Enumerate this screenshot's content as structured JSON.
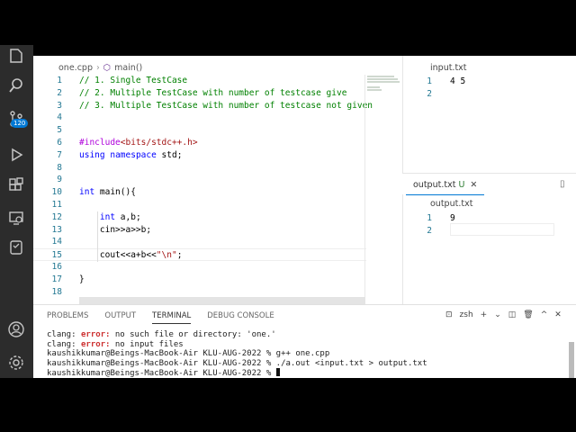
{
  "activity_bar": {
    "source_control_badge": "120"
  },
  "editor": {
    "breadcrumb_file": "one.cpp",
    "breadcrumb_symbol": "main()",
    "lines": [
      {
        "n": "1",
        "html": "<span class=\"cm\">// 1. Single TestCase</span>"
      },
      {
        "n": "2",
        "html": "<span class=\"cm\">// 2. Multiple TestCase with number of testcase give</span>"
      },
      {
        "n": "3",
        "html": "<span class=\"cm\">// 3. Multiple TestCase with number of testcase not given</span>"
      },
      {
        "n": "4",
        "html": ""
      },
      {
        "n": "5",
        "html": ""
      },
      {
        "n": "6",
        "html": "<span class=\"pp\">#include</span><span class=\"st\">&lt;bits/stdc++.h&gt;</span>"
      },
      {
        "n": "7",
        "html": "<span class=\"kw\">using</span> <span class=\"kw\">namespace</span> std;"
      },
      {
        "n": "8",
        "html": ""
      },
      {
        "n": "9",
        "html": ""
      },
      {
        "n": "10",
        "html": "<span class=\"kw\">int</span> main(){"
      },
      {
        "n": "11",
        "html": ""
      },
      {
        "n": "12",
        "html": "    <span class=\"kw\">int</span> a,b;"
      },
      {
        "n": "13",
        "html": "    cin&gt;&gt;a&gt;&gt;b;"
      },
      {
        "n": "14",
        "html": ""
      },
      {
        "n": "15",
        "html": "    cout&lt;&lt;a+b&lt;&lt;<span class=\"st\">\"\\n\"</span>;"
      },
      {
        "n": "16",
        "html": ""
      },
      {
        "n": "17",
        "html": "}"
      },
      {
        "n": "18",
        "html": ""
      }
    ]
  },
  "input_pane": {
    "title": "input.txt",
    "lines": [
      {
        "n": "1",
        "text": "4 5"
      },
      {
        "n": "2",
        "text": ""
      }
    ]
  },
  "output_pane": {
    "tab_label": "output.txt",
    "tab_status": "U",
    "title": "output.txt",
    "lines": [
      {
        "n": "1",
        "text": "9"
      },
      {
        "n": "2",
        "text": ""
      }
    ]
  },
  "panel": {
    "tabs": [
      "PROBLEMS",
      "OUTPUT",
      "TERMINAL",
      "DEBUG CONSOLE"
    ],
    "active_tab": "TERMINAL",
    "shell": "zsh",
    "terminal": {
      "l1_prefix": "clang: ",
      "l1_err": "error:",
      "l1_rest": " no such file or directory: 'one.'",
      "l2_prefix": "clang: ",
      "l2_err": "error:",
      "l2_rest": " no input files",
      "l3": "kaushikkumar@Beings-MacBook-Air KLU-AUG-2022 % g++ one.cpp",
      "l4": "kaushikkumar@Beings-MacBook-Air KLU-AUG-2022 % ./a.out <input.txt > output.txt",
      "l5": "kaushikkumar@Beings-MacBook-Air KLU-AUG-2022 % "
    }
  }
}
